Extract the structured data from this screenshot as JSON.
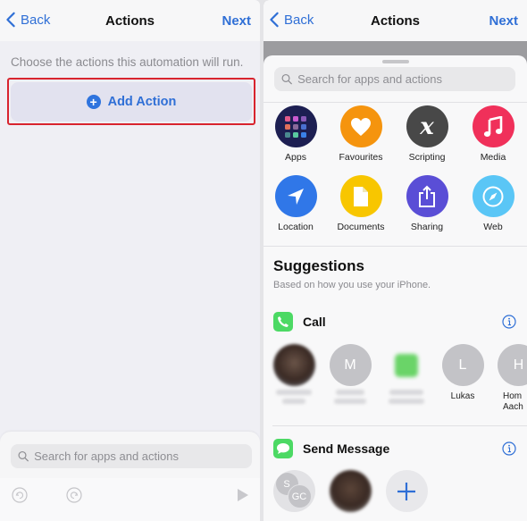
{
  "left": {
    "nav": {
      "back_label": "Back",
      "title": "Actions",
      "next_label": "Next"
    },
    "hint": "Choose the actions this automation will run.",
    "add_action_label": "Add Action",
    "search_placeholder": "Search for apps and actions",
    "toolbar": {
      "undo": "undo-icon",
      "redo": "redo-icon",
      "play": "play-icon"
    }
  },
  "right": {
    "nav": {
      "back_label": "Back",
      "title": "Actions",
      "next_label": "Next"
    },
    "search_placeholder": "Search for apps and actions",
    "categories": [
      {
        "label": "Apps",
        "icon": "apps-grid-icon",
        "color": "#1d1f52"
      },
      {
        "label": "Favourites",
        "icon": "heart-icon",
        "color": "#f5940e"
      },
      {
        "label": "Scripting",
        "icon": "scripting-x-icon",
        "color": "#484848"
      },
      {
        "label": "Media",
        "icon": "music-note-icon",
        "color": "#f0305a"
      },
      {
        "label": "Location",
        "icon": "location-arrow-icon",
        "color": "#3077e8"
      },
      {
        "label": "Documents",
        "icon": "document-icon",
        "color": "#f8c600"
      },
      {
        "label": "Sharing",
        "icon": "share-icon",
        "color": "#5a4ed6"
      },
      {
        "label": "Web",
        "icon": "compass-icon",
        "color": "#5ac6f6"
      }
    ],
    "suggestions": {
      "title": "Suggestions",
      "subtitle": "Based on how you use your iPhone.",
      "call": {
        "label": "Call",
        "contacts": [
          {
            "initial": "",
            "name": "",
            "blurred": true,
            "kind": "photo"
          },
          {
            "initial": "M",
            "name": "",
            "blurred": true,
            "kind": "initial"
          },
          {
            "initial": "",
            "name": "",
            "blurred": true,
            "kind": "green"
          },
          {
            "initial": "L",
            "name": "Lukas",
            "blurred": false,
            "kind": "initial"
          },
          {
            "initial": "H",
            "name": "Hom Aach",
            "blurred": false,
            "kind": "initial"
          }
        ]
      },
      "message": {
        "label": "Send Message",
        "contacts": [
          {
            "initials": [
              "S",
              "GC"
            ],
            "kind": "group"
          },
          {
            "kind": "photo"
          },
          {
            "kind": "add"
          }
        ]
      }
    }
  },
  "colors": {
    "accent": "#2f6fd6",
    "highlight": "#d8242e",
    "call_green": "#4cd964"
  }
}
